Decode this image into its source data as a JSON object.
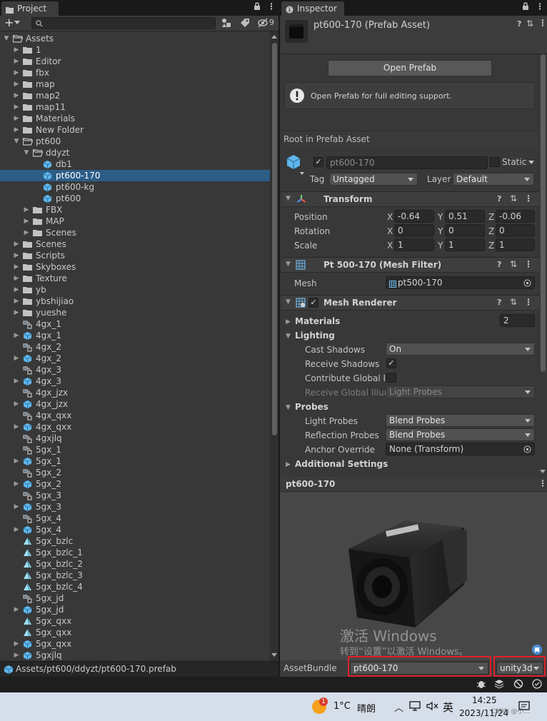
{
  "project": {
    "tab_title": "Project",
    "add_label": "+",
    "hidden_count": "9",
    "tree": [
      {
        "label": "Assets",
        "depth": 0,
        "arrow": "down",
        "icon": "folder-open"
      },
      {
        "label": "1",
        "depth": 1,
        "arrow": "right",
        "icon": "folder"
      },
      {
        "label": "Editor",
        "depth": 1,
        "arrow": "right",
        "icon": "folder"
      },
      {
        "label": "fbx",
        "depth": 1,
        "arrow": "right",
        "icon": "folder"
      },
      {
        "label": "map",
        "depth": 1,
        "arrow": "right",
        "icon": "folder"
      },
      {
        "label": "map2",
        "depth": 1,
        "arrow": "right",
        "icon": "folder"
      },
      {
        "label": "map11",
        "depth": 1,
        "arrow": "right",
        "icon": "folder"
      },
      {
        "label": "Materials",
        "depth": 1,
        "arrow": "right",
        "icon": "folder"
      },
      {
        "label": "New Folder",
        "depth": 1,
        "arrow": "right",
        "icon": "folder"
      },
      {
        "label": "pt600",
        "depth": 1,
        "arrow": "down",
        "icon": "folder-open"
      },
      {
        "label": "ddyzt",
        "depth": 2,
        "arrow": "down",
        "icon": "folder-open"
      },
      {
        "label": "db1",
        "depth": 3,
        "arrow": "",
        "icon": "prefab"
      },
      {
        "label": "pt600-170",
        "depth": 3,
        "arrow": "",
        "icon": "prefab",
        "selected": true
      },
      {
        "label": "pt600-kg",
        "depth": 3,
        "arrow": "",
        "icon": "prefab"
      },
      {
        "label": "pt600",
        "depth": 3,
        "arrow": "",
        "icon": "prefab"
      },
      {
        "label": "FBX",
        "depth": 2,
        "arrow": "right",
        "icon": "folder"
      },
      {
        "label": "MAP",
        "depth": 2,
        "arrow": "right",
        "icon": "folder"
      },
      {
        "label": "Scenes",
        "depth": 2,
        "arrow": "right",
        "icon": "folder"
      },
      {
        "label": "Scenes",
        "depth": 1,
        "arrow": "right",
        "icon": "folder"
      },
      {
        "label": "Scripts",
        "depth": 1,
        "arrow": "right",
        "icon": "folder"
      },
      {
        "label": "Skyboxes",
        "depth": 1,
        "arrow": "right",
        "icon": "folder"
      },
      {
        "label": "Texture",
        "depth": 1,
        "arrow": "right",
        "icon": "folder"
      },
      {
        "label": "yb",
        "depth": 1,
        "arrow": "right",
        "icon": "folder"
      },
      {
        "label": "ybshijiao",
        "depth": 1,
        "arrow": "right",
        "icon": "folder"
      },
      {
        "label": "yueshe",
        "depth": 1,
        "arrow": "right",
        "icon": "folder"
      },
      {
        "label": "4gx_1",
        "depth": 1,
        "arrow": "",
        "icon": "script"
      },
      {
        "label": "4gx_1",
        "depth": 1,
        "arrow": "right",
        "icon": "prefab"
      },
      {
        "label": "4gx_2",
        "depth": 1,
        "arrow": "",
        "icon": "script"
      },
      {
        "label": "4gx_2",
        "depth": 1,
        "arrow": "right",
        "icon": "prefab"
      },
      {
        "label": "4gx_3",
        "depth": 1,
        "arrow": "",
        "icon": "script"
      },
      {
        "label": "4gx_3",
        "depth": 1,
        "arrow": "right",
        "icon": "prefab"
      },
      {
        "label": "4gx_jzx",
        "depth": 1,
        "arrow": "",
        "icon": "script"
      },
      {
        "label": "4gx_jzx",
        "depth": 1,
        "arrow": "right",
        "icon": "prefab"
      },
      {
        "label": "4gx_qxx",
        "depth": 1,
        "arrow": "",
        "icon": "script"
      },
      {
        "label": "4gx_qxx",
        "depth": 1,
        "arrow": "right",
        "icon": "prefab"
      },
      {
        "label": "4gxjlq",
        "depth": 1,
        "arrow": "",
        "icon": "script"
      },
      {
        "label": "5gx_1",
        "depth": 1,
        "arrow": "",
        "icon": "script"
      },
      {
        "label": "5gx_1",
        "depth": 1,
        "arrow": "right",
        "icon": "prefab"
      },
      {
        "label": "5gx_2",
        "depth": 1,
        "arrow": "",
        "icon": "script"
      },
      {
        "label": "5gx_2",
        "depth": 1,
        "arrow": "right",
        "icon": "prefab"
      },
      {
        "label": "5gx_3",
        "depth": 1,
        "arrow": "",
        "icon": "script"
      },
      {
        "label": "5gx_3",
        "depth": 1,
        "arrow": "right",
        "icon": "prefab"
      },
      {
        "label": "5gx_4",
        "depth": 1,
        "arrow": "",
        "icon": "script"
      },
      {
        "label": "5gx_4",
        "depth": 1,
        "arrow": "right",
        "icon": "prefab"
      },
      {
        "label": "5gx_bzlc",
        "depth": 1,
        "arrow": "",
        "icon": "shader"
      },
      {
        "label": "5gx_bzlc_1",
        "depth": 1,
        "arrow": "",
        "icon": "shader"
      },
      {
        "label": "5gx_bzlc_2",
        "depth": 1,
        "arrow": "",
        "icon": "shader"
      },
      {
        "label": "5gx_bzlc_3",
        "depth": 1,
        "arrow": "",
        "icon": "shader"
      },
      {
        "label": "5gx_bzlc_4",
        "depth": 1,
        "arrow": "",
        "icon": "shader"
      },
      {
        "label": "5gx_jd",
        "depth": 1,
        "arrow": "",
        "icon": "script"
      },
      {
        "label": "5gx_jd",
        "depth": 1,
        "arrow": "right",
        "icon": "prefab"
      },
      {
        "label": "5gx_qxx",
        "depth": 1,
        "arrow": "",
        "icon": "shader"
      },
      {
        "label": "5gx_qxx",
        "depth": 1,
        "arrow": "",
        "icon": "shader"
      },
      {
        "label": "5gx_qxx",
        "depth": 1,
        "arrow": "right",
        "icon": "prefab"
      },
      {
        "label": "5gxjlq",
        "depth": 1,
        "arrow": "right",
        "icon": "prefab"
      }
    ],
    "status_path": "Assets/pt600/ddyzt/pt600-170.prefab"
  },
  "inspector": {
    "tab_title": "Inspector",
    "asset_title": "pt600-170 (Prefab Asset)",
    "open_prefab_label": "Open Prefab",
    "help_text": "Open Prefab for full editing support.",
    "root_label": "Root in Prefab Asset",
    "object_name": "pt600-170",
    "static_label": "Static",
    "tag_label": "Tag",
    "tag_value": "Untagged",
    "layer_label": "Layer",
    "layer_value": "Default",
    "transform": {
      "title": "Transform",
      "position_label": "Position",
      "rotation_label": "Rotation",
      "scale_label": "Scale",
      "position": {
        "x": "-0.64",
        "y": "0.51",
        "z": "-0.06"
      },
      "rotation": {
        "x": "0",
        "y": "0",
        "z": "0"
      },
      "scale": {
        "x": "1",
        "y": "1",
        "z": "1"
      },
      "axis_x": "X",
      "axis_y": "Y",
      "axis_z": "Z"
    },
    "mesh_filter": {
      "title": "Pt 500-170 (Mesh Filter)",
      "mesh_label": "Mesh",
      "mesh_value": "pt500-170"
    },
    "mesh_renderer": {
      "title": "Mesh Renderer",
      "materials_label": "Materials",
      "materials_count": "2",
      "lighting_label": "Lighting",
      "cast_shadows_label": "Cast Shadows",
      "cast_shadows_value": "On",
      "receive_shadows_label": "Receive Shadows",
      "contribute_gi_label": "Contribute Global Illu",
      "receive_gi_label": "Receive Global Illum",
      "receive_gi_value": "Light Probes",
      "probes_label": "Probes",
      "light_probes_label": "Light Probes",
      "light_probes_value": "Blend Probes",
      "reflection_probes_label": "Reflection Probes",
      "reflection_probes_value": "Blend Probes",
      "anchor_override_label": "Anchor Override",
      "anchor_override_value": "None (Transform)",
      "additional_settings_label": "Additional Settings"
    },
    "preview_title": "pt600-170",
    "watermark_title": "激活 Windows",
    "watermark_sub": "转到“设置”以激活 Windows。",
    "assetbundle_label": "AssetBundle",
    "assetbundle_name": "pt600-170",
    "assetbundle_variant": "unity3d"
  },
  "taskbar": {
    "weather_badge": "1",
    "temperature": "1°C",
    "weather_text": "晴朗",
    "ime": "英",
    "time": "14:25",
    "date": "2023/11/24",
    "watermark": "CSDN @小..."
  },
  "colors": {
    "selection": "#2c5d87",
    "highlight_box": "#e0202a",
    "prefab_icon": "#5fb6ec"
  }
}
